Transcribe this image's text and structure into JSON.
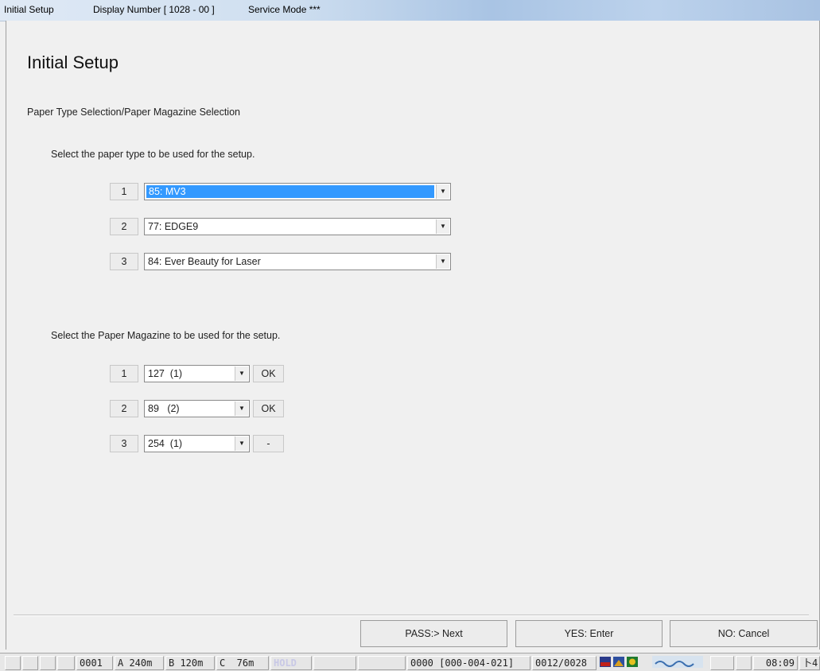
{
  "titlebar": {
    "app": "Initial Setup",
    "display_number": "Display Number [ 1028 - 00 ]",
    "service_mode": "Service Mode  ***"
  },
  "page": {
    "heading": "Initial Setup",
    "section": "Paper Type Selection/Paper Magazine Selection"
  },
  "paper_type": {
    "instruction": "Select the paper type to be used for the setup.",
    "rows": [
      {
        "num": "1",
        "value": "85: MV3",
        "selected": true
      },
      {
        "num": "2",
        "value": "77: EDGE9",
        "selected": false
      },
      {
        "num": "3",
        "value": "84: Ever Beauty for Laser",
        "selected": false
      }
    ]
  },
  "magazine": {
    "instruction": "Select the Paper Magazine to be used for the setup.",
    "rows": [
      {
        "num": "1",
        "value": "127  (1)",
        "status": "OK"
      },
      {
        "num": "2",
        "value": "89   (2)",
        "status": "OK"
      },
      {
        "num": "3",
        "value": "254  (1)",
        "status": "-"
      }
    ]
  },
  "buttons": {
    "pass": "PASS:> Next",
    "yes": "YES: Enter",
    "no": "NO: Cancel"
  },
  "taskbar": {
    "counter": "0001",
    "a": "A 240m",
    "b": "B 120m",
    "c": "C  76m",
    "hold": "HOLD",
    "code": "0000 [000-004-021]",
    "page": "0012/0028",
    "time": "08:09",
    "tail": "卜4"
  },
  "colors": {
    "selection": "#3399ff",
    "background": "#f0f0f0"
  }
}
